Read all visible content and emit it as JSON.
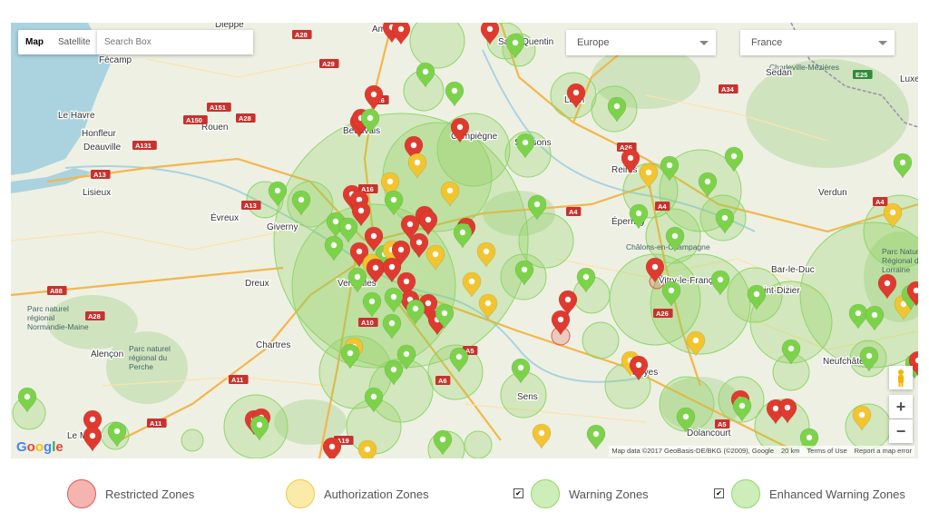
{
  "map": {
    "type_buttons": [
      "Map",
      "Satellite"
    ],
    "search_placeholder": "Search Box",
    "region_select": "Europe",
    "country_select": "France",
    "zoom_in": "+",
    "zoom_out": "−",
    "logo": "Google",
    "attribution": [
      "Map data ©2017 GeoBasis-DE/BKG (©2009), Google",
      "20 km",
      "Terms of Use",
      "Report a map error"
    ],
    "city_labels": [
      "Dieppe",
      "Amiens",
      "Saint-Quentin",
      "Charleville-Mézières",
      "Sedan",
      "Fécamp",
      "Le Havre",
      "Honfleur",
      "Deauville",
      "Rouen",
      "Beauvais",
      "Compiègne",
      "Soissons",
      "Laon",
      "Reims",
      "Lisieux",
      "Évreux",
      "Giverny",
      "Épernay",
      "Châlons-en-Champagne",
      "Verdun",
      "Vitry-le-François",
      "Bar-le-Duc",
      "Saint-Dizier",
      "Dreux",
      "Versailles",
      "Chartres",
      "Alençon",
      "Parc naturel régional du Perche",
      "Parc naturel régional Normandie-Maine",
      "Sens",
      "Troyes",
      "Dolancourt",
      "Neufchâteau",
      "Le Mans",
      "Parc Naturel Régional de Lorraine",
      "Luxe"
    ],
    "road_labels": [
      "A28",
      "A29",
      "A16",
      "A26",
      "A34",
      "A151",
      "A28",
      "A150",
      "A131",
      "A13",
      "A13",
      "A16",
      "A4",
      "A4",
      "A4",
      "A26",
      "A88",
      "A28",
      "A10",
      "A5",
      "A6",
      "A11",
      "A11",
      "A19",
      "A5",
      "E25"
    ],
    "colors": {
      "restricted": "#e03a2f",
      "authorization": "#f2c530",
      "warning": "#7cd34a",
      "land": "#eef0e4",
      "water": "#aad3df",
      "road": "#f5b64a"
    }
  },
  "legend": [
    {
      "label": "Restricted Zones",
      "fill": "#f4b4b0",
      "stroke": "#e05a52",
      "checked": false
    },
    {
      "label": "Authorization Zones",
      "fill": "#fbeba8",
      "stroke": "#f0c94a",
      "checked": false
    },
    {
      "label": "Warning Zones",
      "fill": "#cdeeb8",
      "stroke": "#8fd66a",
      "checked": true
    },
    {
      "label": "Enhanced Warning Zones",
      "fill": "#cdeeb8",
      "stroke": "#8fd66a",
      "checked": true
    }
  ]
}
